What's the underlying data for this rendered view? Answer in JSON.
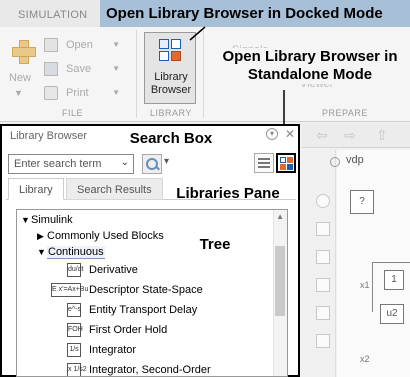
{
  "ribbon": {
    "tab_label": "SIMULATION",
    "banner_title": "Open Library Browser in Docked Mode",
    "new_label": "New",
    "file_items": [
      {
        "label": "Open",
        "icon": "folder-icon"
      },
      {
        "label": "Save",
        "icon": "save-icon"
      },
      {
        "label": "Print",
        "icon": "print-icon"
      }
    ],
    "file_section": "FILE",
    "library_button_label": "Library Browser",
    "library_section": "LIBRARY",
    "signals_label": "Signals",
    "viewer_label": "Viewer",
    "prepare_section": "PREPARE"
  },
  "callouts": {
    "standalone": "Open Library Browser in Standalone Mode",
    "search_box": "Search Box",
    "libraries_pane": "Libraries Pane",
    "tree": "Tree"
  },
  "library_browser": {
    "title": "Library Browser",
    "search_placeholder": "Enter search term",
    "tabs": [
      "Library",
      "Search Results"
    ],
    "tree": {
      "root": "Simulink",
      "nodes": [
        {
          "label": "Commonly Used Blocks",
          "expanded": false
        },
        {
          "label": "Continuous",
          "expanded": true,
          "selected": true
        }
      ],
      "blocks": [
        {
          "label": "Derivative",
          "icon": "du/dt"
        },
        {
          "label": "Descriptor State-Space",
          "icon": "E x'=Ax+Bu"
        },
        {
          "label": "Entity Transport Delay",
          "icon": "e^-s"
        },
        {
          "label": "First Order Hold",
          "icon": "FOH"
        },
        {
          "label": "Integrator",
          "icon": "1/s"
        },
        {
          "label": "Integrator, Second-Order",
          "icon": "x 1/s2"
        }
      ]
    }
  },
  "model": {
    "name": "vdp",
    "block_labels": [
      "1",
      "u2"
    ],
    "signal_labels": [
      "x1",
      "x2"
    ]
  },
  "colors": {
    "banner_bg": "#a8bfd8",
    "accent_blue": "#1c5fb0",
    "panel_border": "#000000"
  }
}
